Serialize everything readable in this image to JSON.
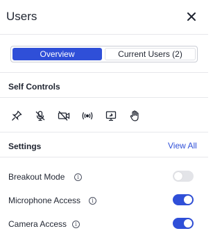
{
  "header": {
    "title": "Users",
    "close_icon": "close-icon"
  },
  "tabs": [
    {
      "label": "Overview",
      "active": true
    },
    {
      "label": "Current Users (2)",
      "active": false
    }
  ],
  "self_controls": {
    "title": "Self Controls",
    "icons": [
      "pin-icon",
      "mic-off-icon",
      "camera-off-icon",
      "broadcast-icon",
      "share-screen-icon",
      "raise-hand-icon"
    ]
  },
  "settings": {
    "title": "Settings",
    "view_all_label": "View All",
    "items": [
      {
        "label": "Breakout Mode",
        "enabled": false
      },
      {
        "label": "Microphone Access",
        "enabled": true
      },
      {
        "label": "Camera Access",
        "enabled": true
      }
    ]
  },
  "colors": {
    "accent": "#2f4fd8",
    "toggle_off": "#e3e4e8",
    "divider": "#e6e7eb"
  }
}
